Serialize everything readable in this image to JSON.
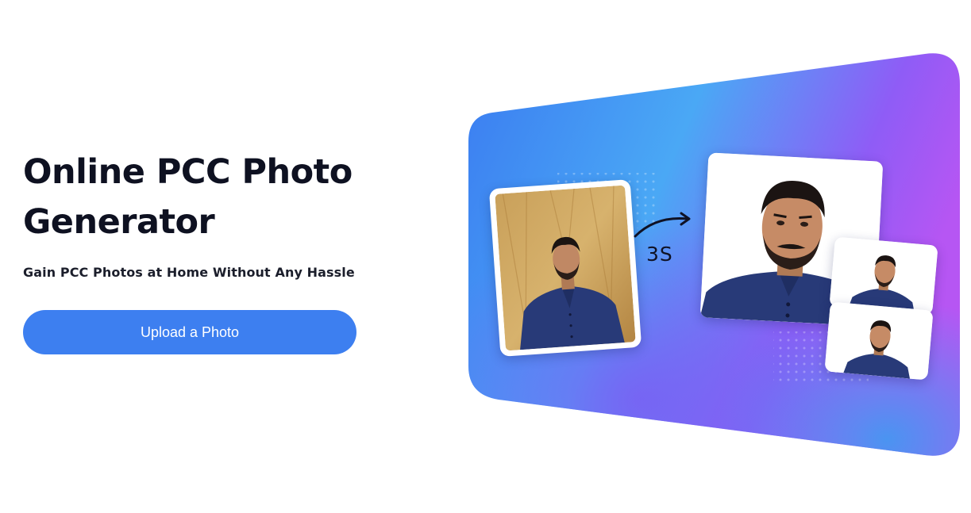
{
  "hero": {
    "title_line1": "Online PCC Photo",
    "title_line2": "Generator",
    "subtitle": "Gain PCC Photos at Home Without Any Hassle",
    "upload_button_label": "Upload a Photo"
  },
  "banner": {
    "duration_label": "3S",
    "icons": {
      "arrow": "curved-arrow-right-icon"
    }
  },
  "colors": {
    "accent": "#3d7ff0",
    "heading": "#0e1121",
    "banner_blue": "#3b82f0",
    "banner_purple": "#a855f7"
  }
}
